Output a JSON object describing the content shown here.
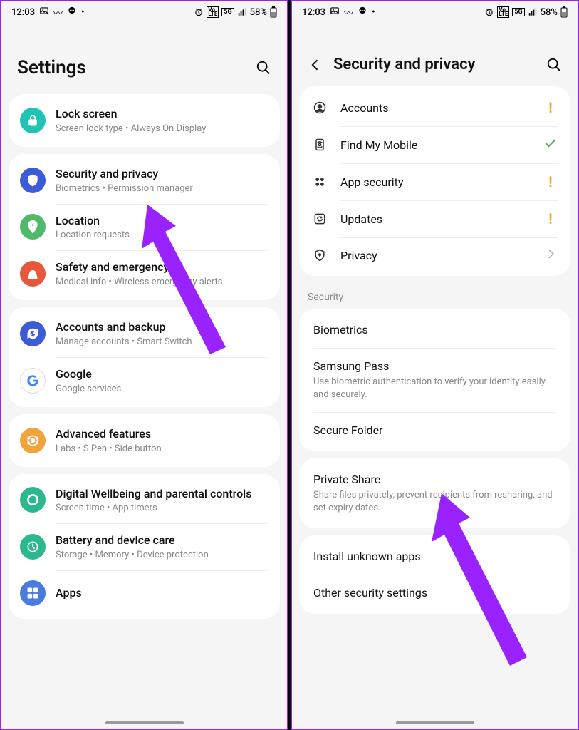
{
  "status": {
    "time": "12:03",
    "battery_pct": "58%",
    "net_label": "5G",
    "lte_label": "VoLTE"
  },
  "left": {
    "title": "Settings",
    "groups": [
      {
        "rows": [
          {
            "title": "Lock screen",
            "sub": "Screen lock type  •  Always On Display",
            "icon": "lock",
            "color": "#1fc4b4"
          }
        ]
      },
      {
        "rows": [
          {
            "title": "Security and privacy",
            "sub": "Biometrics  •  Permission manager",
            "icon": "shield",
            "color": "#3b5bd9"
          },
          {
            "title": "Location",
            "sub": "Location requests",
            "icon": "location",
            "color": "#4fb96a"
          },
          {
            "title": "Safety and emergency",
            "sub": "Medical info  •  Wireless emergency alerts",
            "icon": "emergency",
            "color": "#e6573d"
          }
        ]
      },
      {
        "rows": [
          {
            "title": "Accounts and backup",
            "sub": "Manage accounts  •  Smart Switch",
            "icon": "sync",
            "color": "#3b5bd9"
          },
          {
            "title": "Google",
            "sub": "Google services",
            "icon": "google",
            "color": "#fff"
          }
        ]
      },
      {
        "rows": [
          {
            "title": "Advanced features",
            "sub": "Labs  •  S Pen  •  Side button",
            "icon": "advanced",
            "color": "#f0a43b"
          }
        ]
      },
      {
        "rows": [
          {
            "title": "Digital Wellbeing and parental controls",
            "sub": "Screen time  •  App timers",
            "icon": "wellbeing",
            "color": "#2bb88f"
          },
          {
            "title": "Battery and device care",
            "sub": "Storage  •  Memory  •  Device protection",
            "icon": "battery",
            "color": "#2bb88f"
          },
          {
            "title": "Apps",
            "sub": "",
            "icon": "apps",
            "color": "#4a7be0"
          }
        ]
      }
    ]
  },
  "right": {
    "title": "Security and privacy",
    "top": [
      {
        "title": "Accounts",
        "icon": "account",
        "indicator": "warn"
      },
      {
        "title": "Find My Mobile",
        "icon": "findmy",
        "indicator": "ok"
      },
      {
        "title": "App security",
        "icon": "appsec",
        "indicator": "warn"
      },
      {
        "title": "Updates",
        "icon": "updates",
        "indicator": "warn"
      },
      {
        "title": "Privacy",
        "icon": "privacy",
        "indicator": "chev"
      }
    ],
    "section_label": "Security",
    "security": [
      {
        "title": "Biometrics",
        "sub": ""
      },
      {
        "title": "Samsung Pass",
        "sub": "Use biometric authentication to verify your identity easily and securely."
      },
      {
        "title": "Secure Folder",
        "sub": ""
      }
    ],
    "security2": [
      {
        "title": "Private Share",
        "sub": "Share files privately, prevent recipients from resharing, and set expiry dates."
      }
    ],
    "security3": [
      {
        "title": "Install unknown apps",
        "sub": ""
      },
      {
        "title": "Other security settings",
        "sub": ""
      }
    ]
  }
}
